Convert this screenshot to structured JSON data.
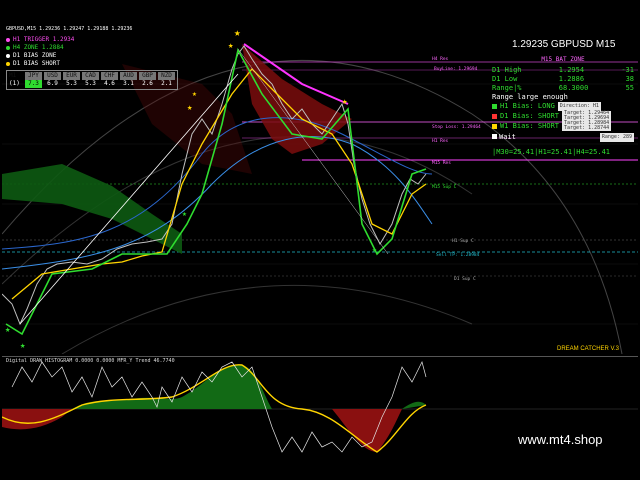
{
  "chart": {
    "header": "GBPUSD,M15 1.29236 1.29247 1.29188 1.29236",
    "legend": [
      {
        "label": "H1 TRIGGER 1.2934",
        "color": "#ff4df2"
      },
      {
        "label": "H4 ZONE 1.2884",
        "color": "#2fdc2f"
      },
      {
        "label": "D1 BIAS ZONE",
        "color": "#ffffff"
      },
      {
        "label": "D1 BIAS SHORT",
        "color": "#ffd400"
      }
    ],
    "currency_strength": {
      "headers": [
        "M1",
        "JPY",
        "USD",
        "EUR",
        "CAD",
        "CHF",
        "AUD",
        "GBP",
        "NZD"
      ],
      "values": [
        "(1)",
        "7.3",
        "6.9",
        "5.3",
        "5.3",
        "4.6",
        "3.1",
        "2.6",
        "2.1"
      ]
    },
    "levels": {
      "h4_res": "H4 Res",
      "buy_line": "BuyLine: 1.29694",
      "stop_loss": "Stop Loss: 1.29464",
      "h1_res": "H1 Res",
      "m15_res": "M15 Res",
      "m15_sup": "M15 Sup C",
      "h1_sup": "H1 Sup C",
      "sell_tp": "Sell TP: 1.28984",
      "d1_sup": "D1 Sup C"
    },
    "indicator_name": "DREAM CATCHER V.3",
    "oscillator_label": "Digital DRAW HISTOGRAM 0.0000 0.0000 MFR_Y Trend 46.7740"
  },
  "panel": {
    "price": "1.29235 GBPUSD M15",
    "zone_title": "M15 BAT ZONE",
    "d1_high_label": "D1 High",
    "d1_high_value": "1.2954",
    "d1_high_diff": "-31",
    "d1_low_label": "D1 Low",
    "d1_low_value": "1.2886",
    "d1_low_diff": "38",
    "range_label": "Range|%",
    "range_value": "68.3000",
    "range_pct": "55",
    "range_note": "Range large enough",
    "h1_bias": "H1 Bias: LONG",
    "h1_tag": "Direction: H1",
    "d1_bias": "D1 Bias: SHORT",
    "d1_tag1": "Target: 1.29464",
    "d1_tag2": "Target: 1.29694",
    "w1_bias": "W1 Bias: SHORT",
    "w1_tag1": "Target: 1.28984",
    "w1_tag2": "Target: 1.28744",
    "wait": "Wait",
    "range_box": "Range: 289",
    "tf_summary": "|M30=25.41|H1=25.41|H4=25.41"
  },
  "footer": {
    "url": "www.mt4.shop"
  }
}
